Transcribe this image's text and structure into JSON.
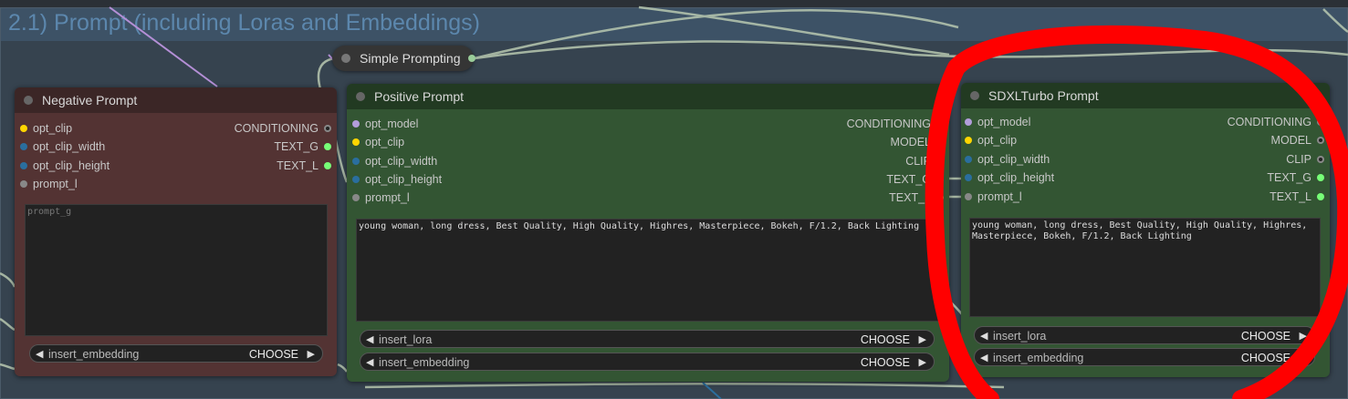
{
  "group": {
    "title": "2.1) Prompt (including Loras and Embeddings)"
  },
  "simple_prompting": {
    "title": "Simple Prompting"
  },
  "negative": {
    "title": "Negative Prompt",
    "inputs": [
      "opt_clip",
      "opt_clip_width",
      "opt_clip_height",
      "prompt_l"
    ],
    "outputs": [
      "CONDITIONING",
      "TEXT_G",
      "TEXT_L"
    ],
    "text_placeholder": "prompt_g",
    "combos": [
      {
        "label": "insert_embedding",
        "value": "CHOOSE"
      }
    ]
  },
  "positive": {
    "title": "Positive Prompt",
    "inputs": [
      "opt_model",
      "opt_clip",
      "opt_clip_width",
      "opt_clip_height",
      "prompt_l"
    ],
    "outputs": [
      "CONDITIONING",
      "MODEL",
      "CLIP",
      "TEXT_G",
      "TEXT_L"
    ],
    "text": "young woman, long dress, Best Quality, High Quality, Highres, Masterpiece, Bokeh, F/1.2, Back Lighting",
    "combos": [
      {
        "label": "insert_lora",
        "value": "CHOOSE"
      },
      {
        "label": "insert_embedding",
        "value": "CHOOSE"
      }
    ]
  },
  "sdxl": {
    "title": "SDXLTurbo Prompt",
    "inputs": [
      "opt_model",
      "opt_clip",
      "opt_clip_width",
      "opt_clip_height",
      "prompt_l"
    ],
    "outputs": [
      "CONDITIONING",
      "MODEL",
      "CLIP",
      "TEXT_G",
      "TEXT_L"
    ],
    "text": "young woman, long dress, Best Quality, High Quality, Highres,\nMasterpiece, Bokeh, F/1.2, Back Lighting",
    "combos": [
      {
        "label": "insert_lora",
        "value": "CHOOSE"
      },
      {
        "label": "insert_embedding",
        "value": "CHOOSE"
      }
    ]
  },
  "colors": {
    "negative_body": "#533333",
    "negative_title": "#3b2626",
    "positive_body": "#335533",
    "positive_title": "#223a22",
    "annotation": "#ff0000",
    "pin_clip": "#ffd500",
    "pin_model": "#b39ddb",
    "pin_int": "#2a6e9e",
    "pin_string": "#888888"
  }
}
